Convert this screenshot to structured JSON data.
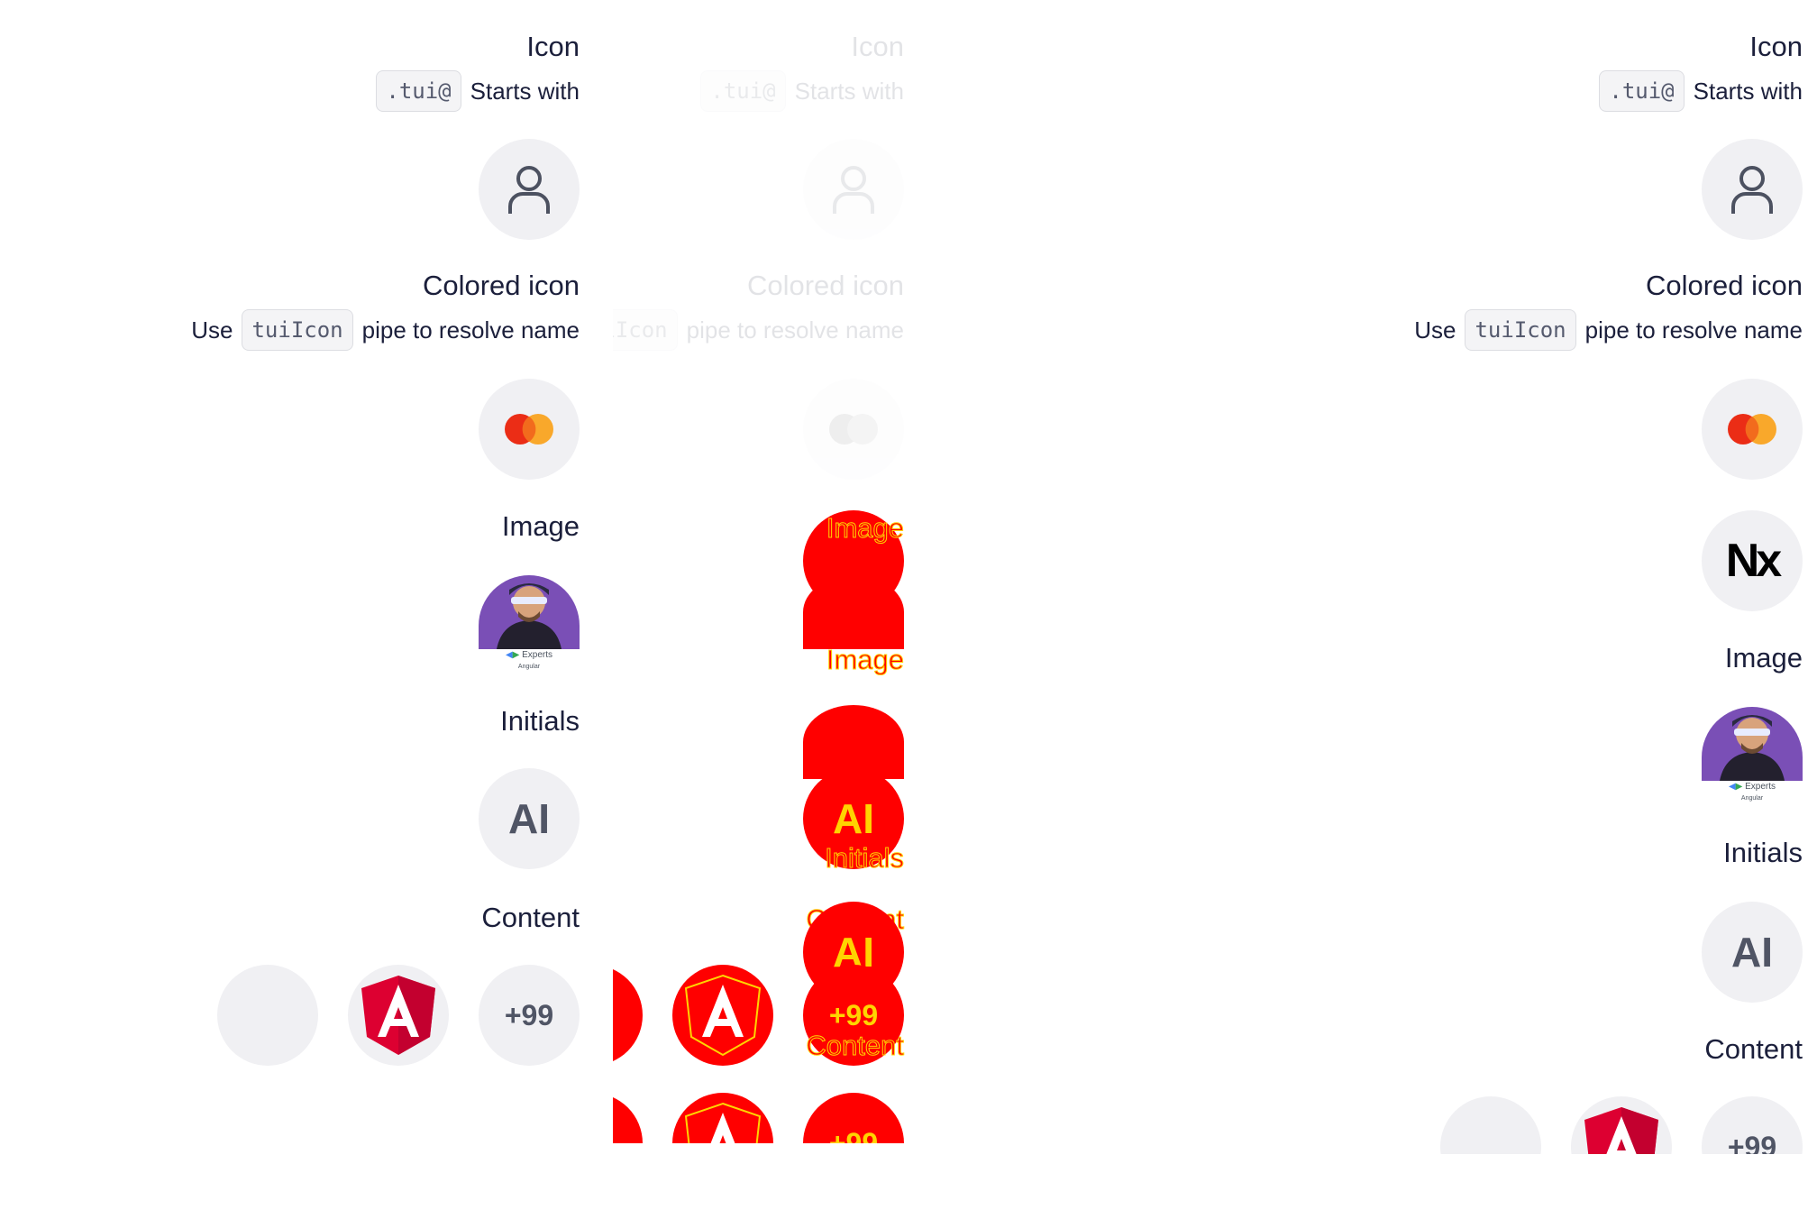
{
  "icon_section": {
    "title": "Icon",
    "prefix_code": ".tui@",
    "prefix_text": "Starts with",
    "icon": "user-icon"
  },
  "colored_icon_section": {
    "title": "Colored icon",
    "use": "Use",
    "code": "tuiIcon",
    "rest": "pipe to resolve name",
    "icon": "mastercard-icon"
  },
  "logo": {
    "text": "Nx"
  },
  "image_section": {
    "title": "Image",
    "caption": "Experts",
    "caption_sub": "Angular"
  },
  "initials_section": {
    "title": "Initials",
    "initials": "AI"
  },
  "content_section": {
    "title": "Content",
    "more_label": "+99",
    "logo_letter": "A"
  },
  "colors": {
    "text": "#1b1f3b",
    "muted_bg": "#f0f0f3",
    "angular_red": "#dd0031",
    "mastercard_red": "#eb001b",
    "mastercard_orange": "#f79e1b",
    "debug_red": "#ff0000",
    "debug_yellow": "#ffd400"
  }
}
